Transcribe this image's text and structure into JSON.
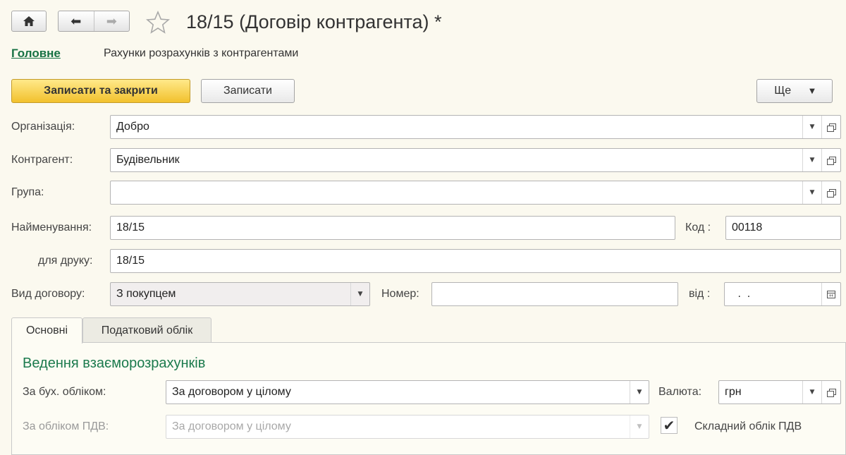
{
  "nav": {
    "home_icon": "home-icon",
    "back_icon": "arrow-left-icon",
    "forward_icon": "arrow-right-icon",
    "favorite_icon": "star-icon",
    "title": "18/15 (Договір контрагента) *"
  },
  "breadcrumb": {
    "main": "Головне",
    "sub": "Рахунки розрахунків з контрагентами"
  },
  "toolbar": {
    "save_close": "Записати та закрити",
    "save": "Записати",
    "more": "Ще"
  },
  "form": {
    "organization": {
      "label": "Організація:",
      "value": "Добро"
    },
    "counterparty": {
      "label": "Контрагент:",
      "value": "Будівельник"
    },
    "group": {
      "label": "Група:",
      "value": ""
    },
    "name": {
      "label": "Найменування:",
      "value": "18/15"
    },
    "code": {
      "label": "Код :",
      "value": "00118"
    },
    "print_name": {
      "label": "для друку:",
      "value": "18/15"
    },
    "contract_type": {
      "label": "Вид договору:",
      "value": "З покупцем"
    },
    "number": {
      "label": "Номер:",
      "value": ""
    },
    "date": {
      "label": "від :",
      "value": " .  ."
    }
  },
  "tabs": [
    {
      "label": "Основні",
      "active": true
    },
    {
      "label": "Податковий облік",
      "active": false
    }
  ],
  "main_tab": {
    "section_title": "Ведення взаєморозрахунків",
    "accounting": {
      "label": "За бух. обліком:",
      "value": "За договором у цілому"
    },
    "vat": {
      "label": "За обліком ПДВ:",
      "value": "За договором у цілому"
    },
    "currency": {
      "label": "Валюта:",
      "value": "грн"
    },
    "complex_vat": {
      "label": "Складний облік ПДВ",
      "checked": true
    }
  }
}
